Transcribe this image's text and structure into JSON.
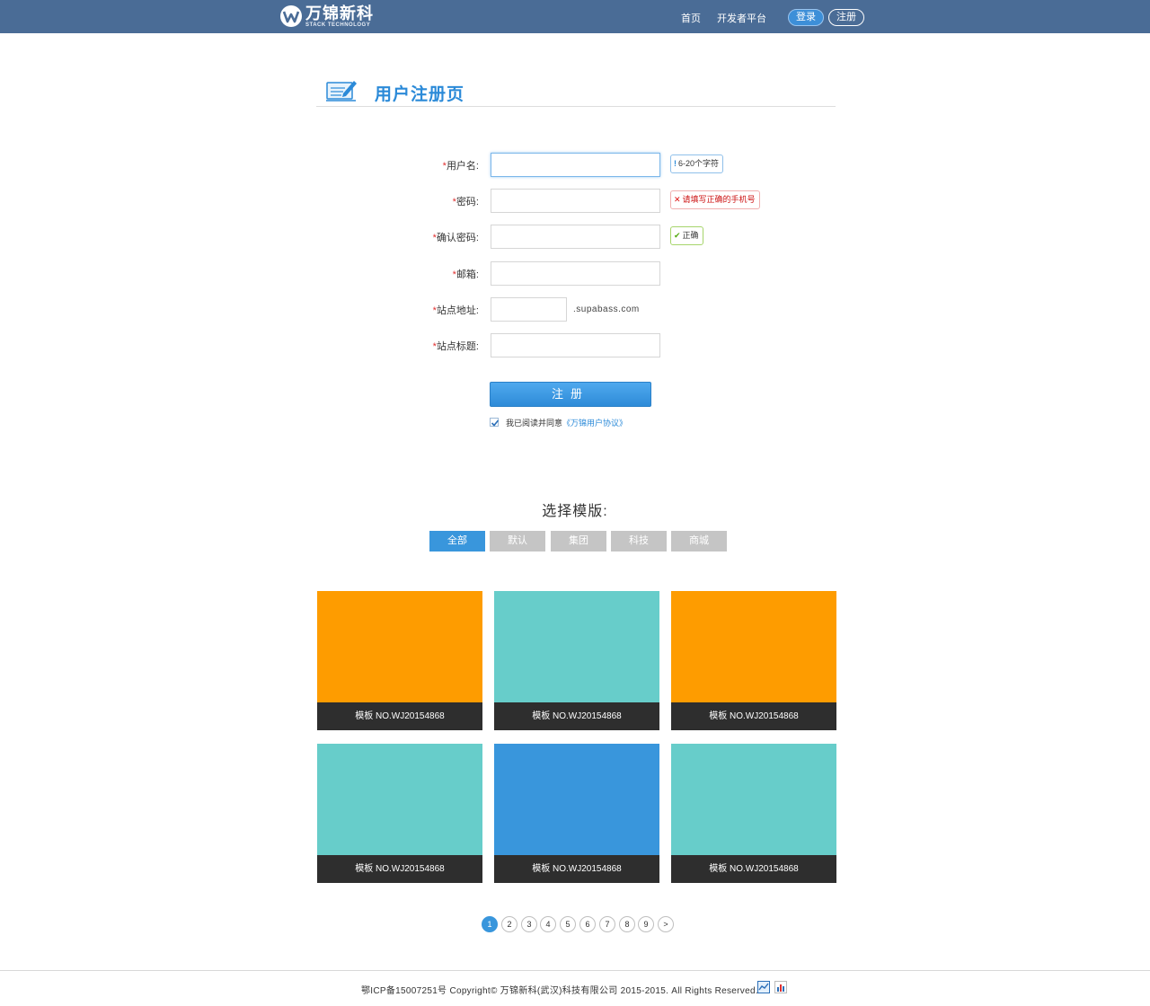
{
  "header": {
    "logo_name": "万锦新科",
    "logo_sub": "STACK TECHNOLOGY",
    "nav": {
      "home": "首页",
      "developer": "开发者平台"
    },
    "login_label": "登录",
    "register_label": "注册"
  },
  "page": {
    "title": "用户注册页"
  },
  "form": {
    "username": {
      "label": "用户名:",
      "value": "",
      "tip": "6-20个字符",
      "tip_mark": "!"
    },
    "password": {
      "label": "密码:",
      "value": "",
      "tip": "请填写正确的手机号",
      "tip_mark": "✕"
    },
    "confirm": {
      "label": "确认密码:",
      "value": "",
      "tip": "正确",
      "tip_mark": "✔"
    },
    "email": {
      "label": "邮箱:",
      "value": ""
    },
    "site_address": {
      "label": "站点地址:",
      "value": "",
      "suffix": ".supabass.com"
    },
    "site_title": {
      "label": "站点标题:",
      "value": ""
    },
    "required_mark": "*",
    "submit_label": "注册",
    "agree_text": "我已阅读并同意",
    "agree_link": "《万锦用户协议》",
    "agree_checked": true
  },
  "templates": {
    "heading": "选择模版:",
    "categories": [
      "全部",
      "默认",
      "集团",
      "科技",
      "商城"
    ],
    "active_category": "全部",
    "cards": [
      {
        "caption": "模板 NO.WJ20154868",
        "color": "#fe9c00"
      },
      {
        "caption": "模板 NO.WJ20154868",
        "color": "#67cdca"
      },
      {
        "caption": "模板 NO.WJ20154868",
        "color": "#fe9c00"
      },
      {
        "caption": "模板 NO.WJ20154868",
        "color": "#67cdca"
      },
      {
        "caption": "模板 NO.WJ20154868",
        "color": "#3996dc"
      },
      {
        "caption": "模板 NO.WJ20154868",
        "color": "#67cdca"
      }
    ]
  },
  "pagination": {
    "pages": [
      "1",
      "2",
      "3",
      "4",
      "5",
      "6",
      "7",
      "8",
      "9"
    ],
    "current": "1",
    "next_label": ">"
  },
  "footer": {
    "text": "鄂ICP备15007251号 Copyright© 万锦新科(武汉)科技有限公司 2015-2015. All Rights Reserved."
  },
  "colors": {
    "header_bg": "#4a6c96",
    "accent": "#3996dc",
    "orange": "#fe9c00",
    "teal": "#67cdca"
  }
}
